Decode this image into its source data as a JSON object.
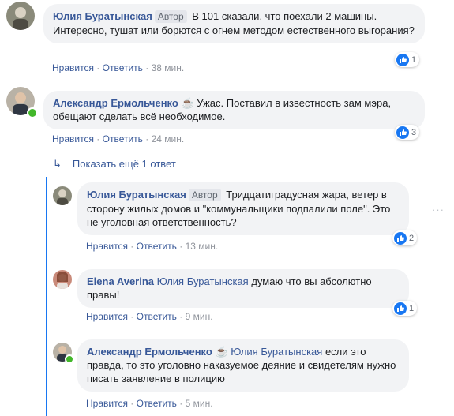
{
  "comments": [
    {
      "author": "Юлия Буратынская",
      "badge": "Автор",
      "text": "В 101 сказали, что поехали 2 машины. Интересно, тушат или борются с огнем методом естественного выгорания?",
      "like": "Нравится",
      "reply": "Ответить",
      "time": "38 мин.",
      "reactions": "1"
    },
    {
      "author": "Александр Ермольченко",
      "emoji": "☕",
      "text": "Ужас. Поставил в известность зам мэра, обещают сделать всё необходимое.",
      "like": "Нравится",
      "reply": "Ответить",
      "time": "24 мин.",
      "reactions": "3"
    }
  ],
  "show_more": "Показать ещё 1 ответ",
  "replies": [
    {
      "author": "Юлия Буратынская",
      "badge": "Автор",
      "text": "Тридцатиградусная жара, ветер в сторону жилых домов и \"коммунальщики подпалили поле\". Это не уголовная ответственность?",
      "like": "Нравится",
      "reply": "Ответить",
      "time": "13 мин.",
      "reactions": "2"
    },
    {
      "author": "Elena Averina",
      "mention": "Юлия Буратынская",
      "text": "думаю что вы абсолютно правы!",
      "like": "Нравится",
      "reply": "Ответить",
      "time": "9 мин.",
      "reactions": "1"
    },
    {
      "author": "Александр Ермольченко",
      "emoji": "☕",
      "mention": "Юлия Буратынская",
      "text": "если это правда, то это уголовно наказуемое деяние и свидетелям нужно писать заявление в полицию",
      "like": "Нравится",
      "reply": "Ответить",
      "time": "5 мин."
    }
  ],
  "separator": "·",
  "colors": {
    "link": "#385898",
    "bubble": "#f2f3f5",
    "like_blue": "#1877f2",
    "online": "#42b72a"
  }
}
